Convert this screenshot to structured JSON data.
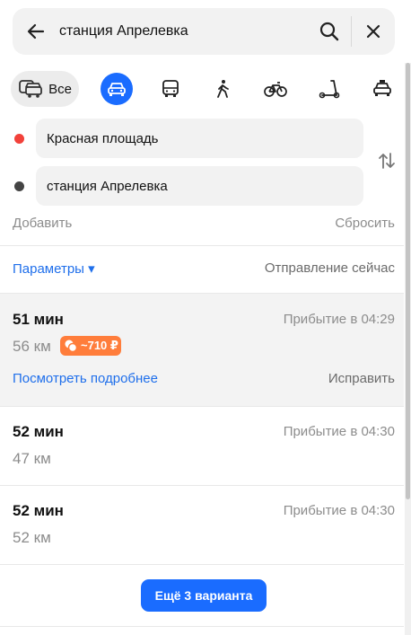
{
  "search": {
    "query": "станция Апрелевка"
  },
  "modes": {
    "all_label": "Все",
    "items": [
      "car",
      "bus",
      "walk",
      "bicycle",
      "scooter",
      "taxi"
    ],
    "active": "car",
    "active_color": "#1a6cff"
  },
  "route_points": {
    "from": {
      "text": "Красная площадь",
      "color": "#f2413a"
    },
    "to": {
      "text": "станция Апрелевка",
      "color": "#444444"
    }
  },
  "actions": {
    "add": "Добавить",
    "reset": "Сбросить"
  },
  "params": {
    "label": "Параметры ▾",
    "departure": "Отправление сейчас"
  },
  "routes": [
    {
      "time": "51 мин",
      "arrival": "Прибытие в 04:29",
      "distance": "56 км",
      "price": "~710 ₽",
      "details": "Посмотреть подробнее",
      "fix": "Исправить",
      "selected": true
    },
    {
      "time": "52 мин",
      "arrival": "Прибытие в 04:30",
      "distance": "47 км"
    },
    {
      "time": "52 мин",
      "arrival": "Прибытие в 04:30",
      "distance": "52 км"
    }
  ],
  "more_button": "Ещё 3 варианта"
}
